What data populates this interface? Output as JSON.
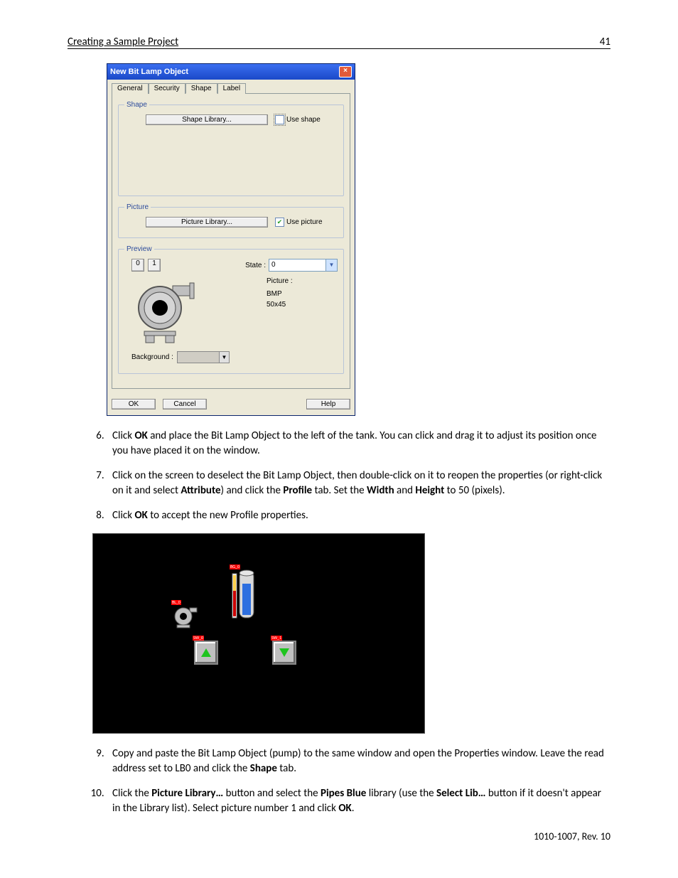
{
  "header": {
    "title": "Creating a Sample Project",
    "pageNum": "41"
  },
  "dialog": {
    "title": "New  Bit Lamp Object",
    "tabs": [
      "General",
      "Security",
      "Shape",
      "Label"
    ],
    "activeTab": "Shape",
    "shape": {
      "btn": "Shape Library...",
      "useShape": "Use shape"
    },
    "picture": {
      "btn": "Picture Library...",
      "usePicture": "Use picture"
    },
    "preview": {
      "legend": "Preview",
      "stateBtn0": "0",
      "stateBtn1": "1",
      "stateLabel": "State :",
      "stateValue": "0",
      "pictureLabel": "Picture :",
      "pictureType": "BMP",
      "pictureSize": "50x45",
      "backgroundLabel": "Background :"
    },
    "buttons": {
      "ok": "OK",
      "cancel": "Cancel",
      "help": "Help"
    },
    "groupShape": "Shape",
    "groupPicture": "Picture"
  },
  "steps": {
    "s6a": "Click ",
    "s6b": "OK",
    "s6c": " and place the Bit Lamp Object to the left of the tank. You can click and drag it to adjust its position once you have placed it on the window.",
    "s7a": "Click on the screen to deselect the Bit Lamp Object, then double-click on it to reopen the properties (or right-click on it and select ",
    "s7b": "Attribute",
    "s7c": ") and click the ",
    "s7d": "Profile",
    "s7e": " tab. Set the ",
    "s7f": "Width",
    "s7g": " and ",
    "s7h": "Height",
    "s7i": " to 50 (pixels).",
    "s8a": "Click ",
    "s8b": "OK",
    "s8c": " to accept the new Profile properties.",
    "s9a": "Copy and paste the Bit Lamp Object (pump) to the same window and open the Properties window. Leave the read address set to LB0 and click the ",
    "s9b": "Shape",
    "s9c": " tab.",
    "s10a": "Click the ",
    "s10b": "Picture Library…",
    "s10c": " button and select the ",
    "s10d": "Pipes Blue",
    "s10e": " library (use the ",
    "s10f": "Select Lib…",
    "s10g": " button if it doesn't appear in the Library list). Select picture number 1 and click ",
    "s10h": "OK",
    "s10i": "."
  },
  "footer": "1010-1007, Rev. 10"
}
